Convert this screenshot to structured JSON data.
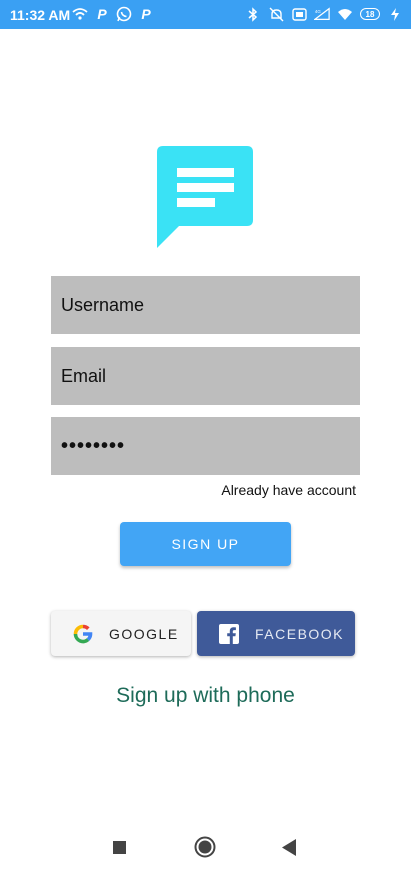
{
  "status": {
    "time": "11:32 AM",
    "left_icons": [
      "wifi-calling-icon",
      "p-icon",
      "whatsapp-icon",
      "p-icon"
    ],
    "right_icons": [
      "bluetooth-icon",
      "mute-bell-icon",
      "data-saver-icon",
      "signal-icon",
      "wifi-icon",
      "battery-icon"
    ],
    "battery": "18"
  },
  "logo": {
    "icon": "chat-bubble-icon",
    "color": "#3ae2f5"
  },
  "form": {
    "username_placeholder": "Username",
    "email_placeholder": "Email",
    "password_mask": "••••••••"
  },
  "already_account": "Already have account",
  "signup_button": "SIGN UP",
  "social": {
    "google_label": "GOOGLE",
    "facebook_label": "FACEBOOK"
  },
  "phone_signup": "Sign up with phone",
  "colors": {
    "status_bar": "#3aa0f3",
    "primary_button": "#42a5f5",
    "facebook": "#3f5a99",
    "field_bg": "#bdbdbd",
    "link": "#1e6b59"
  }
}
